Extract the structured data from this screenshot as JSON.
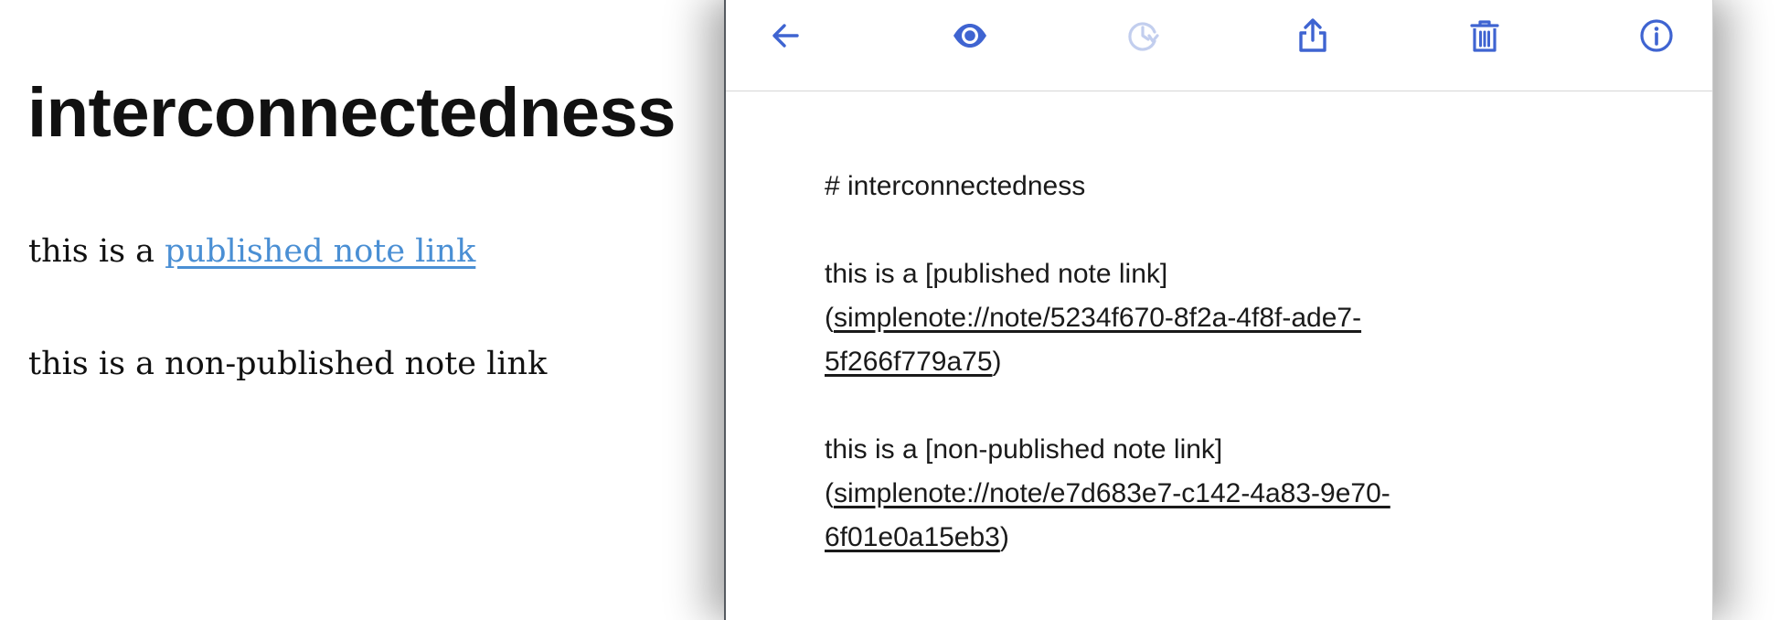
{
  "published": {
    "title": "interconnectedness",
    "para1_prefix": "this is a ",
    "para1_link": "published note link",
    "para2": "this is a non-published note link"
  },
  "toolbar": {
    "back_icon": "arrow-left-icon",
    "preview_icon": "eye-icon",
    "history_icon": "history-clock-icon",
    "share_icon": "share-upload-icon",
    "trash_icon": "trash-icon",
    "info_icon": "info-icon",
    "accent_color": "#3f64d1"
  },
  "editor": {
    "heading_line": "# interconnectedness",
    "line1": "this is a [published note link]",
    "line2_open": "(",
    "line2_url": "simplenote://note/5234f670-8f2a-4f8f-ade7-",
    "line3_url": "5f266f779a75",
    "line3_close": ")",
    "line4": "this is a [non-published note link]",
    "line5_open": "(",
    "line5_url": "simplenote://note/e7d683e7-c142-4a83-9e70-",
    "line6_url": "6f01e0a15eb3",
    "line6_close": ")"
  }
}
